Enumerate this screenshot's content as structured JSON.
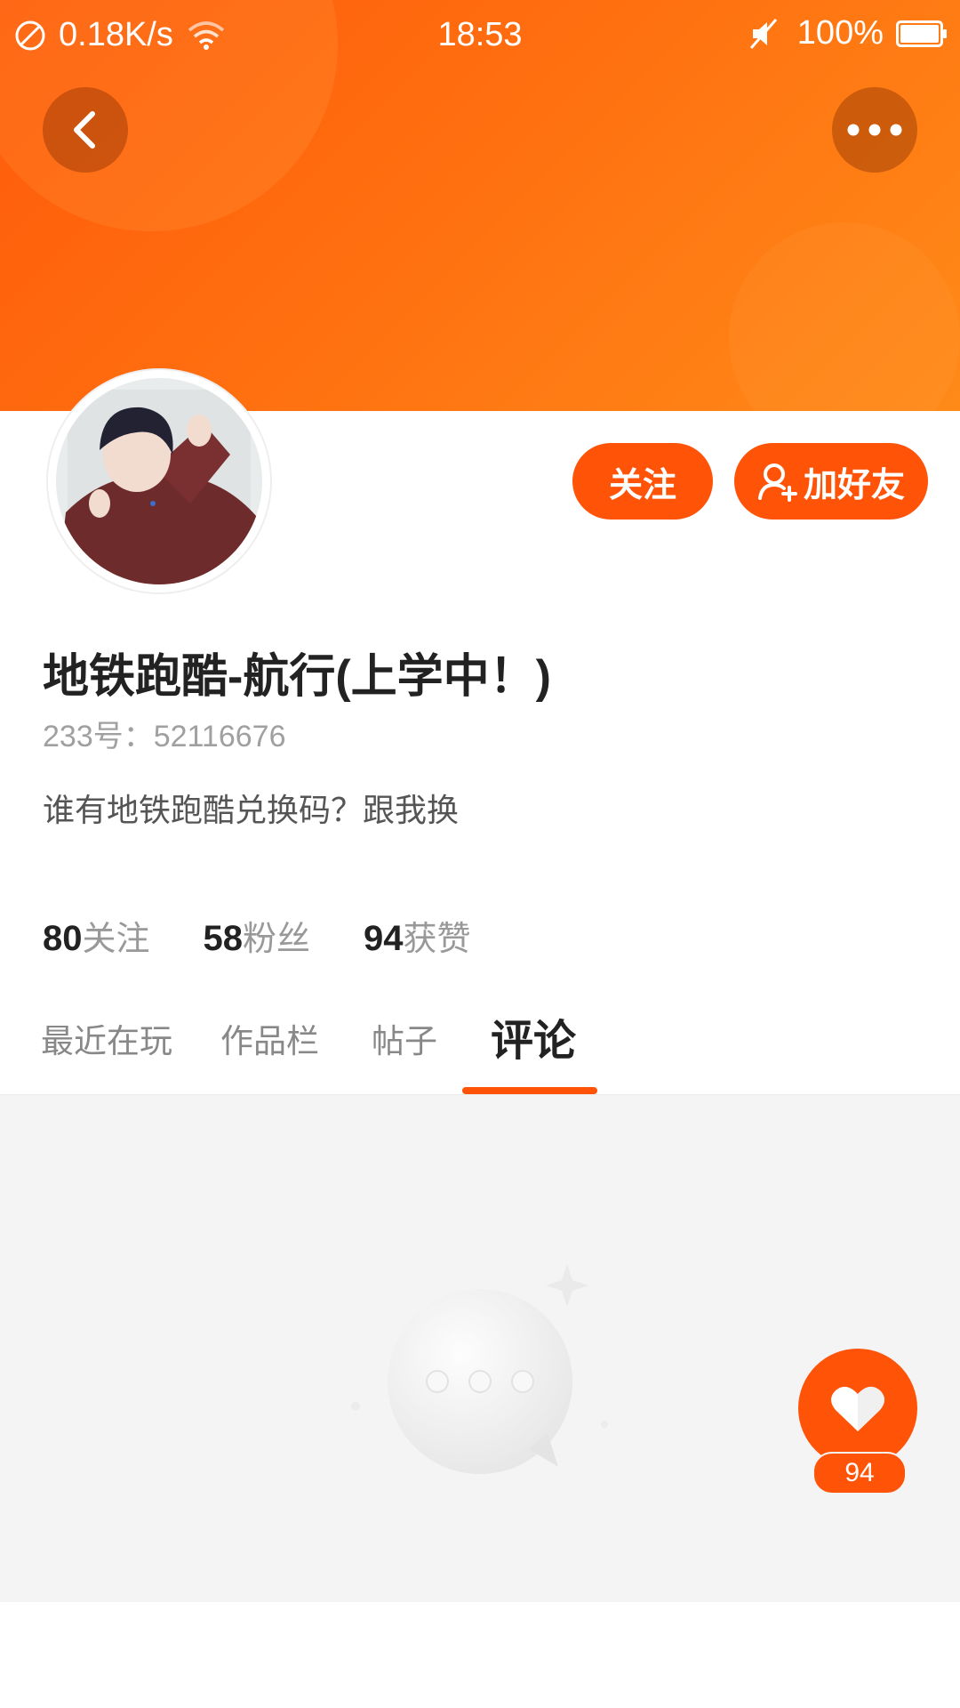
{
  "status_bar": {
    "network_speed": "0.18K/s",
    "time": "18:53",
    "battery": "100%",
    "icons": [
      "no-sim-icon",
      "wifi-icon",
      "mute-icon",
      "battery-icon"
    ]
  },
  "header": {
    "back_icon": "chevron-left-icon",
    "more_icon": "more-dots-icon",
    "colors": {
      "banner_start": "#ff5a0a",
      "banner_end": "#ff8a18"
    }
  },
  "profile": {
    "nickname": "地铁跑酷-航行(上学中！)",
    "user_id": "233号：52116676",
    "bio": "谁有地铁跑酷兑换码？跟我换",
    "avatar_icon": "avatar-image"
  },
  "actions": {
    "follow_label": "关注",
    "add_friend_label": "加好友",
    "add_friend_icon": "add-person-icon",
    "accent": "#ff5308"
  },
  "stats": {
    "following_count": "80",
    "following_label": "关注",
    "fans_count": "58",
    "fans_label": "粉丝",
    "likes_count": "94",
    "likes_label": "获赞"
  },
  "tabs": [
    {
      "label": "最近在玩",
      "active": false
    },
    {
      "label": "作品栏",
      "active": false
    },
    {
      "label": "帖子",
      "active": false
    },
    {
      "label": "评论",
      "active": true
    }
  ],
  "empty_state": {
    "icon": "empty-comment-bubble-icon"
  },
  "like_button": {
    "icon": "heart-icon",
    "count": "94"
  }
}
